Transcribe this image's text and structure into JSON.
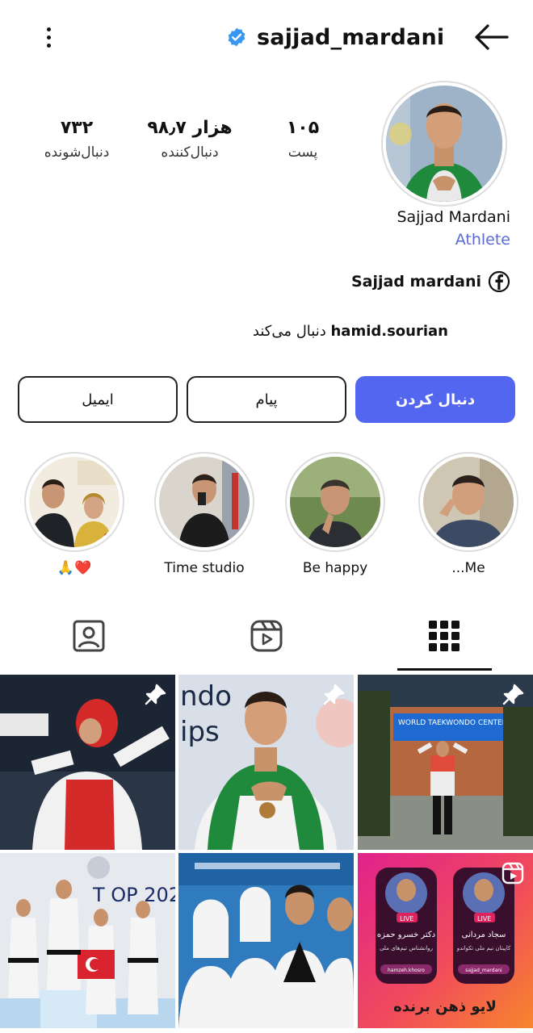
{
  "header": {
    "username": "sajjad_mardani"
  },
  "stats": {
    "following": {
      "value": "۷۳۲",
      "label": "دنبال‌شونده"
    },
    "followers": {
      "value": "۹۸٫۷ هزار",
      "label": "دنبال‌کننده"
    },
    "posts": {
      "value": "۱۰۵",
      "label": "پست"
    }
  },
  "profile": {
    "full_name": "Sajjad Mardani",
    "category": "Athlete",
    "facebook_name": "Sajjad mardani",
    "followed_by_user": "hamid.sourian",
    "followed_by_text": "دنبال می‌کند"
  },
  "actions": {
    "follow": "دنبال کردن",
    "message": "پیام",
    "email": "ایمیل"
  },
  "highlights": [
    {
      "label": "...Me"
    },
    {
      "label": "Be happy"
    },
    {
      "label": "Time studio"
    },
    {
      "label": "🙏❤️"
    }
  ],
  "tabs": [
    "posts-grid",
    "reels",
    "tagged"
  ],
  "grid_overlays": {
    "live_text": "LIVE",
    "post5_headline": "لایو ذهن برنده",
    "post5_left_name": "دکتر خسرو حمزه",
    "post5_left_role": "روانشناس تیم‌های ملی",
    "post5_left_handle": "hamzeh.khosro",
    "post5_right_name": "سجاد مردانی",
    "post5_right_role": "کاپیتان تیم ملی تکواندو",
    "post5_right_handle": "sajjad_mardani",
    "post3_sign": "WORLD TAEKWONDO CENTER"
  },
  "colors": {
    "accent": "#5266ef",
    "verified": "#3897f0",
    "category": "#5a6bd6"
  }
}
